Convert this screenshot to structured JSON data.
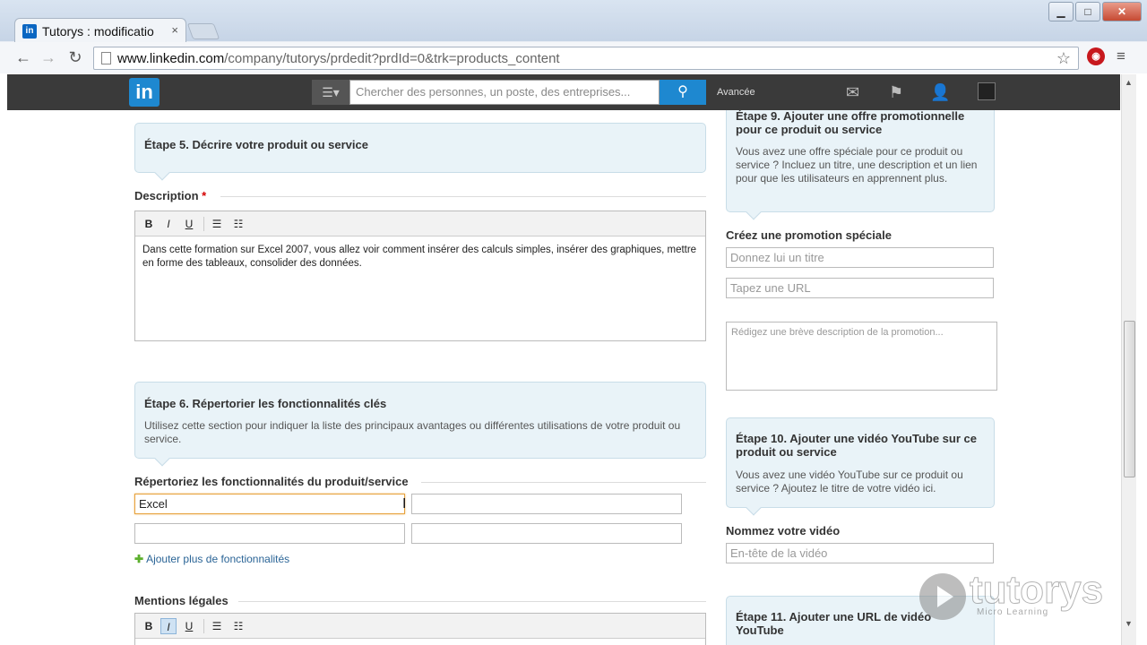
{
  "browser": {
    "tab_title": "Tutorys : modificatio",
    "tab_close": "×",
    "url_host": "www.linkedin.com",
    "url_path": "/company/tutorys/prdedit?prdId=0&trk=products_content",
    "minimize": "▁",
    "maximize": "□",
    "close": "✕"
  },
  "linkedin": {
    "logo": "in",
    "search_placeholder": "Chercher des personnes, un poste, des entreprises...",
    "advanced": "Avancée"
  },
  "left": {
    "step5_title": "Étape 5. Décrire votre produit ou service",
    "description_label": "Description",
    "required_mark": "*",
    "description_text": "Dans cette formation sur Excel 2007, vous allez voir comment insérer des calculs simples, insérer des graphiques, mettre en forme des tableaux, consolider des données.",
    "step6_title": "Étape 6. Répertorier les fonctionnalités clés",
    "step6_text": "Utilisez cette section pour indiquer la liste des principaux avantages ou différentes utilisations de votre produit ou service.",
    "features_label": "Répertoriez les fonctionnalités du produit/service",
    "feature1_value": "Excel",
    "add_features": "Ajouter plus de fonctionnalités",
    "legal_label": "Mentions légales"
  },
  "editor": {
    "bold": "B",
    "italic": "I",
    "underline": "U"
  },
  "right": {
    "step9_title": "Étape 9. Ajouter une offre promotionnelle pour ce produit ou service",
    "step9_text": "Vous avez une offre spéciale pour ce produit ou service ? Incluez un titre, une description et un lien pour que les utilisateurs en apprennent plus.",
    "promo_label": "Créez une promotion spéciale",
    "promo_title_placeholder": "Donnez lui un titre",
    "promo_url_placeholder": "Tapez une URL",
    "promo_desc_placeholder": "Rédigez une brève description de la promotion...",
    "step10_title": "Étape 10. Ajouter une vidéo YouTube sur ce produit ou service",
    "step10_text": "Vous avez une vidéo YouTube sur ce produit ou service ? Ajoutez le titre de votre vidéo ici.",
    "video_label": "Nommez votre vidéo",
    "video_placeholder": "En-tête de la vidéo",
    "step11_title": "Étape 11. Ajouter une URL de vidéo YouTube"
  },
  "watermark": {
    "brand": "tutorys",
    "tagline": "Micro Learning"
  }
}
